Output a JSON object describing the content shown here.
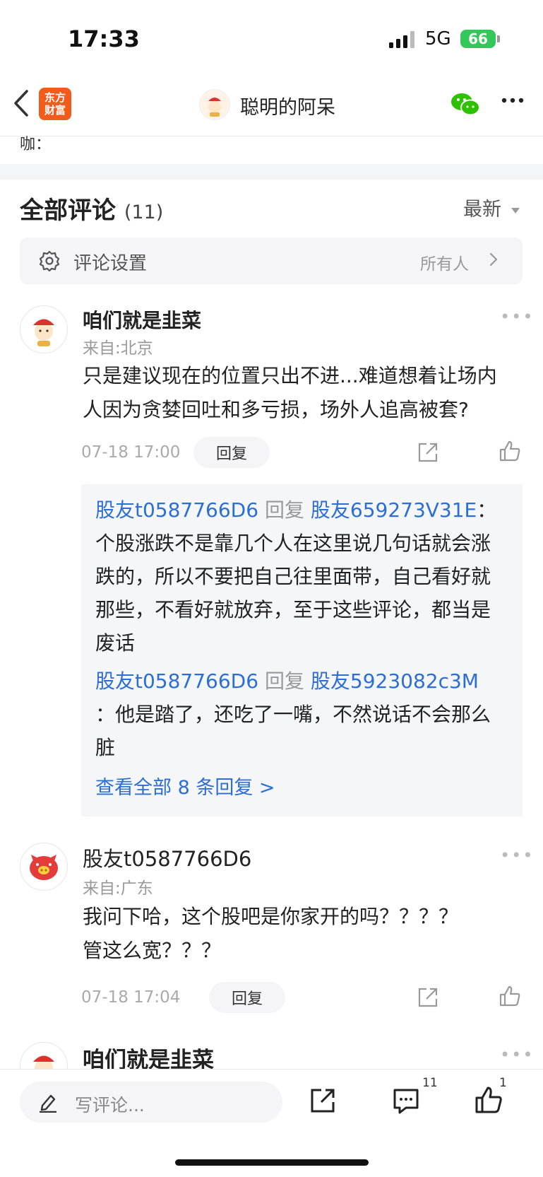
{
  "status_bar": {
    "time": "17:33",
    "network": "5G",
    "battery": "66"
  },
  "nav": {
    "logo_line1": "东方",
    "logo_line2": "财富",
    "title": "聪明的阿呆"
  },
  "cut_text": "咖：",
  "comments_header": {
    "title": "全部评论",
    "count": "(11)",
    "sort": "最新"
  },
  "settings": {
    "label": "评论设置",
    "value": "所有人"
  },
  "comments": [
    {
      "username": "咱们就是韭菜",
      "location": "来自:北京",
      "text_line1": "只是建议现在的位置只出不进...难道想着让场内",
      "text_line2": "人因为贪婪回吐和多亏损，场外人追高被套?",
      "time": "07-18 17:00",
      "reply_label": "回复",
      "replies": [
        {
          "from": "股友t0587766D6",
          "verb": "回复",
          "to": "股友659273V31E",
          "colon": "：",
          "lines": [
            "个股涨跌不是靠几个人在这里说几句话就会涨",
            "跌的，所以不要把自己往里面带，自己看好就",
            "那些，不看好就放弃，至于这些评论，都当是",
            "废话"
          ]
        },
        {
          "from": "股友t0587766D6",
          "verb": "回复",
          "to": "股友5923082c3M",
          "lines": [
            "：他是踏了，还吃了一嘴，不然说话不会那么",
            "脏"
          ]
        }
      ],
      "view_all": "查看全部 8 条回复 >"
    },
    {
      "username": "股友t0587766D6",
      "location": "来自:广东",
      "text_line1": "我问下哈，这个股吧是你家开的吗？？？？",
      "text_line2": "管这么宽？？？",
      "time": "07-18 17:04",
      "reply_label": "回复"
    },
    {
      "username": "咱们就是韭菜"
    }
  ],
  "bottom_bar": {
    "placeholder": "写评论...",
    "comment_count": "11",
    "like_count": "1"
  },
  "colors": {
    "link_blue": "#2c6ed6",
    "brand_orange": "#f25b1c",
    "wechat_green": "#34c759"
  }
}
